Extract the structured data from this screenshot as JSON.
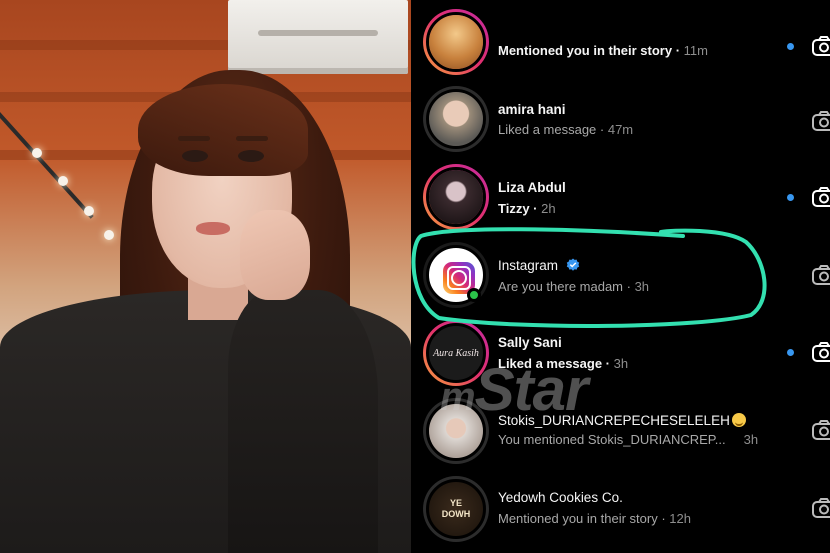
{
  "watermark": {
    "prefix": "m",
    "main": "Star"
  },
  "activity": [
    {
      "name": "",
      "text": "Mentioned you in their story",
      "time": "11m",
      "text_strong": true,
      "unread": true,
      "avatar": "desert-story",
      "story_ring": true
    },
    {
      "name": "amira hani",
      "text": "Liked a message",
      "time": "47m",
      "text_strong": false,
      "unread": false,
      "avatar": "amira",
      "story_ring": false
    },
    {
      "name": "Liza Abdul",
      "text": "Tizzy",
      "time": "2h",
      "text_strong": true,
      "unread": true,
      "avatar": "liza",
      "story_ring": true
    },
    {
      "name": "Instagram",
      "text": "Are you there madam",
      "time": "3h",
      "text_strong": false,
      "unread": false,
      "avatar": "instagram-logo",
      "verified": true,
      "online": true
    },
    {
      "name": "Sally Sani",
      "text": "Liked a message",
      "time": "3h",
      "text_strong": true,
      "unread": true,
      "avatar": "aura-kasih",
      "avatar_text": "Aura Kasih",
      "story_ring": true
    },
    {
      "name": "Stokis_DURIANCREPECHESELELEH",
      "text": "You mentioned Stokis_DURIANCREP...",
      "time": "3h",
      "text_strong": false,
      "unread": false,
      "avatar": "stokis",
      "emoji": "smile"
    },
    {
      "name": "Yedowh Cookies Co.",
      "text": "Mentioned you in their story",
      "time": "12h",
      "text_strong": false,
      "unread": false,
      "avatar": "ye-dowh",
      "avatar_text": "YE DOWH"
    }
  ],
  "colors": {
    "highlight_ring": "#33e0b0",
    "unread_dot": "#3897f0",
    "verified": "#3897f0"
  },
  "icons": {
    "camera": "camera-icon",
    "verified": "verified-badge-icon"
  }
}
